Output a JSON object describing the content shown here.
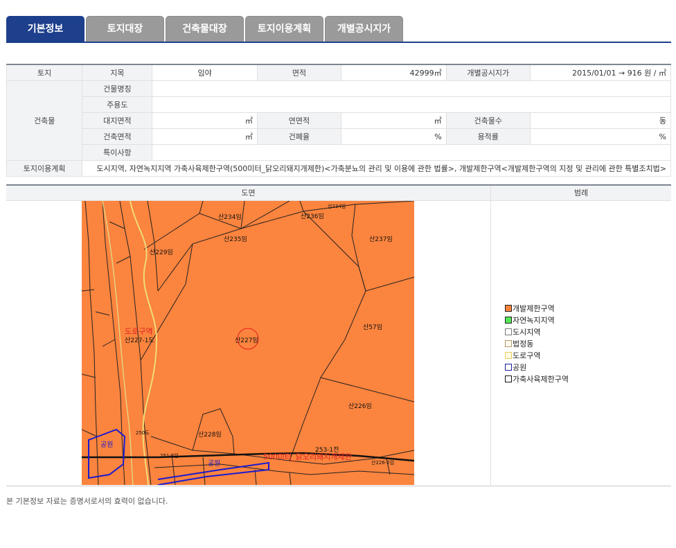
{
  "tabs": [
    {
      "label": "기본정보",
      "active": true
    },
    {
      "label": "토지대장",
      "active": false
    },
    {
      "label": "건축물대장",
      "active": false
    },
    {
      "label": "토지이용계획",
      "active": false
    },
    {
      "label": "개별공시지가",
      "active": false
    }
  ],
  "info": {
    "land_header": "토지",
    "jimok_label": "지목",
    "jimok_value": "임야",
    "area_label": "면적",
    "area_value": "42999㎡",
    "price_label": "개별공시지가",
    "price_value": "2015/01/01 → 916 원 / ㎡",
    "building_header": "건축물",
    "bldg_name_label": "건물명칭",
    "use_label": "주용도",
    "site_area_label": "대지면적",
    "site_area_value": "㎡",
    "total_floor_label": "연면적",
    "total_floor_value": "㎡",
    "bldg_count_label": "건축물수",
    "bldg_count_value": "동",
    "bldg_area_label": "건축면적",
    "bldg_area_value": "㎡",
    "coverage_label": "건폐율",
    "coverage_value": "%",
    "far_label": "용적률",
    "far_value": "%",
    "special_label": "특이사항",
    "landuse_label": "토지이용계획",
    "landuse_value": "도시지역, 자연녹지지역 가축사육제한구역(500미터_닭오리돼지개제한)<가축분뇨의 관리 및 이용에 관한 법률>, 개발제한구역<개발제한구역의 지정 및 관리에 관한 특별조치법>"
  },
  "map_section": {
    "map_header": "도면",
    "legend_header": "범례",
    "labels": {
      "l234": "산234임",
      "l236": "산236임",
      "l234b": "산234임",
      "l235": "산235임",
      "l237": "산237임",
      "l229": "산229임",
      "road_zone": "도로구역",
      "l227_1": "산227-1도",
      "l227": "산227임",
      "l57": "산57임",
      "l226": "산226임",
      "l228": "산228임",
      "l250": "250도",
      "l253": "253-1전",
      "park1": "공원",
      "park2": "공원",
      "livestock": "500미터_닭오리돼지개제한",
      "l251": "251-2임",
      "l226_2": "산226-2임"
    }
  },
  "legend": [
    {
      "label": "개발제한구역",
      "color": "#fb843e"
    },
    {
      "label": "자연녹지지역",
      "color": "#55e855"
    },
    {
      "label": "도시지역",
      "color": "#ffffff"
    },
    {
      "label": "법정동",
      "color": "#fff8ee"
    },
    {
      "label": "도로구역",
      "color": "#fffbe0"
    },
    {
      "label": "공원",
      "color": "#ffffff"
    },
    {
      "label": "가축사육제한구역",
      "color": "#ffffff"
    }
  ],
  "legend_borders": [
    "#222222",
    "#222222",
    "#777777",
    "#b09a70",
    "#e8cf60",
    "#1a1aa0",
    "#111111"
  ],
  "footer_note": "본 기본정보 자료는 증명서로서의 효력이 없습니다."
}
